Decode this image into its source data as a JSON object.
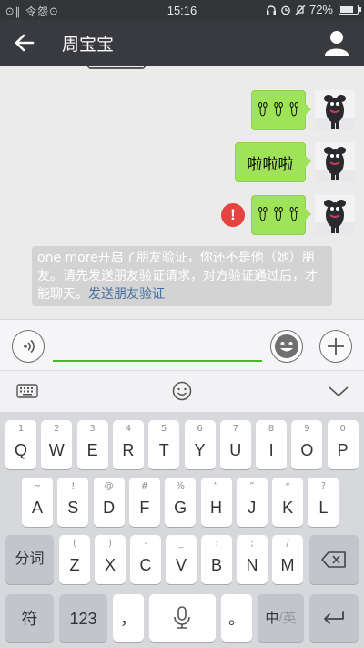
{
  "status_bar": {
    "carrier_text": "ꖴ∥ 令怨ꖴ",
    "time": "15:16",
    "battery": "72%",
    "battery_level": 0.72
  },
  "header": {
    "back_icon": "arrow-left-icon",
    "title": "周宝宝",
    "contact_icon": "person-icon"
  },
  "messages": [
    {
      "type": "emoji",
      "emoji": [
        "ꀎ",
        "ꀎ",
        "ꀎ"
      ],
      "failed": false
    },
    {
      "type": "text",
      "text": "啦啦啦",
      "failed": false
    },
    {
      "type": "emoji",
      "emoji": [
        "ꀎ",
        "ꀎ",
        "ꀎ"
      ],
      "failed": true,
      "error_mark": "!"
    }
  ],
  "system_message": {
    "text": "one more开启了朋友验证，你还不是他（她）朋友。请先发送朋友验证请求，对方验证通过后，才能聊天。",
    "link": "发送朋友验证"
  },
  "input_bar": {
    "voice_icon": "voice-icon",
    "input_value": "",
    "emoji_icon": "emoji-icon",
    "plus_icon": "plus-icon"
  },
  "keyboard_toolbar": {
    "keyboard_icon": "keyboard-icon",
    "smiley_icon": "smiley-icon",
    "collapse_icon": "chevron-down-icon"
  },
  "keyboard": {
    "row1": [
      {
        "sub": "1",
        "main": "Q"
      },
      {
        "sub": "2",
        "main": "W"
      },
      {
        "sub": "3",
        "main": "E"
      },
      {
        "sub": "4",
        "main": "R"
      },
      {
        "sub": "5",
        "main": "T"
      },
      {
        "sub": "6",
        "main": "Y"
      },
      {
        "sub": "7",
        "main": "U"
      },
      {
        "sub": "8",
        "main": "I"
      },
      {
        "sub": "9",
        "main": "O"
      },
      {
        "sub": "0",
        "main": "P"
      }
    ],
    "row2": [
      {
        "sub": "~",
        "main": "A"
      },
      {
        "sub": "!",
        "main": "S"
      },
      {
        "sub": "@",
        "main": "D"
      },
      {
        "sub": "#",
        "main": "F"
      },
      {
        "sub": "%",
        "main": "G"
      },
      {
        "sub": "“",
        "main": "H"
      },
      {
        "sub": "”",
        "main": "J"
      },
      {
        "sub": "*",
        "main": "K"
      },
      {
        "sub": "?",
        "main": "L"
      }
    ],
    "row3": [
      {
        "sub": "(",
        "main": "Z"
      },
      {
        "sub": ")",
        "main": "X"
      },
      {
        "sub": "-",
        "main": "C"
      },
      {
        "sub": "_",
        "main": "V"
      },
      {
        "sub": ":",
        "main": "B"
      },
      {
        "sub": ";",
        "main": "N"
      },
      {
        "sub": "/",
        "main": "M"
      }
    ],
    "segment_key": "分词",
    "delete_icon": "backspace-icon",
    "symbol_key": "符",
    "num_key": "123",
    "comma_key": "，",
    "mic_icon": "microphone-icon",
    "period_key": "。",
    "lang_key_zh": "中",
    "lang_key_en": "/英",
    "enter_icon": "enter-icon"
  }
}
